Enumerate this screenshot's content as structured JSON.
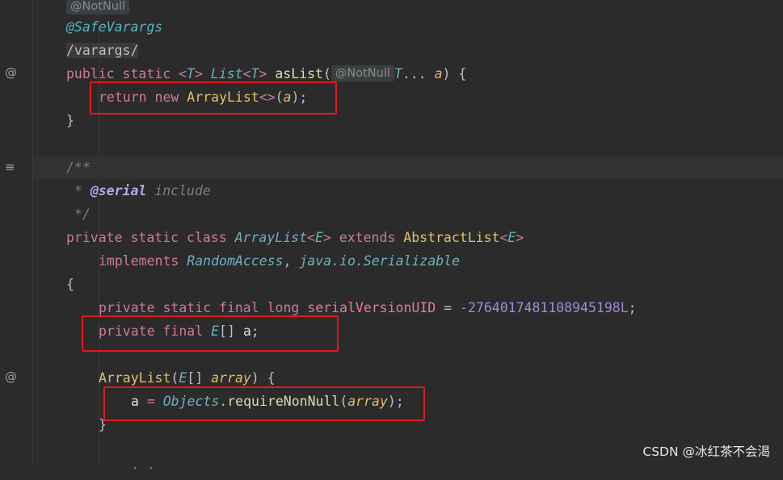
{
  "gutter": {
    "icon_override_1": "@",
    "icon_doc": "≡",
    "icon_override_2": "@"
  },
  "code": {
    "l0_hint": "@NotNull",
    "l1_ann": "@SafeVarargs",
    "l2_path": "/varargs/",
    "l3_public": "public static ",
    "l3_lt": "<",
    "l3_T": "T",
    "l3_gt": "> ",
    "l3_List": "List",
    "l3_lt2": "<",
    "l3_T2": "T",
    "l3_gt2": "> ",
    "l3_name": "asList",
    "l3_paren": "(",
    "l3_hint": "@NotNull",
    "l3_T3": "T",
    "l3_dots": "... ",
    "l3_a": "a",
    "l3_end": ") {",
    "l4_return": "return new ",
    "l4_ArrayList": "ArrayList",
    "l4_diamond": "<>",
    "l4_po": "(",
    "l4_a": "a",
    "l4_pc": ");",
    "l5_brace": "}",
    "l7_cmt": "/**",
    "l8_star": " * ",
    "l8_tag": "@serial",
    "l8_include": " include",
    "l9_end": " */",
    "l10_private": "private static class ",
    "l10_ArrayList": "ArrayList",
    "l10_lt": "<",
    "l10_E": "E",
    "l10_gt": "> ",
    "l10_extends": "extends ",
    "l10_Abstract": "AbstractList",
    "l10_lt2": "<",
    "l10_E2": "E",
    "l10_gt2": ">",
    "l11_implements": "implements ",
    "l11_Random": "RandomAccess",
    "l11_comma": ", ",
    "l11_Serial": "java.io.Serializable",
    "l12_brace": "{",
    "l13_private": "private static final long ",
    "l13_serial": "serialVersionUID",
    "l13_eq": " = ",
    "l13_num": "-2764017481108945198L",
    "l13_semi": ";",
    "l14_private": "private final ",
    "l14_E": "E",
    "l14_arr": "[] ",
    "l14_a": "a",
    "l14_semi": ";",
    "l16_ArrayList": "ArrayList",
    "l16_po": "(",
    "l16_E": "E",
    "l16_arr": "[] ",
    "l16_array": "array",
    "l16_end": ") {",
    "l17_a": "a",
    "l17_eq": " = ",
    "l17_Objects": "Objects",
    "l17_dot": ".",
    "l17_req": "requireNonNull",
    "l17_po": "(",
    "l17_array": "array",
    "l17_pc": ");",
    "l18_brace": "}",
    "l19_partial": "· ·"
  },
  "watermark": "CSDN @冰红茶不会渴"
}
